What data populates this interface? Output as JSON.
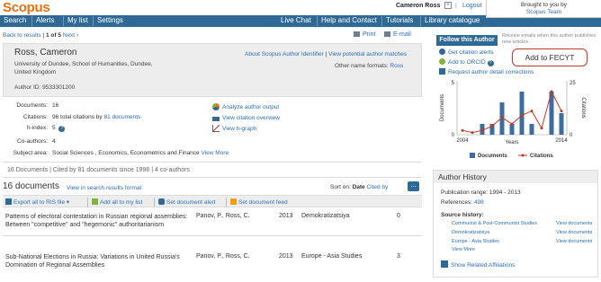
{
  "header": {
    "logo": "Scopus",
    "user_name": "Cameron Ross",
    "user_plus": "+",
    "logout": "Logout",
    "brought_line1": "Brought to you by",
    "brought_line2": "Scopus Team"
  },
  "nav": {
    "left": [
      "Search",
      "Alerts",
      "My list",
      "Settings"
    ],
    "right": [
      "Live Chat",
      "Help and Contact",
      "Tutorials",
      "Library catalogue"
    ]
  },
  "subbar": {
    "back": "Back to results",
    "pager": "1 of 5",
    "next": "Next",
    "print": "Print",
    "email": "E-mail"
  },
  "author": {
    "name": "Ross, Cameron",
    "affiliation": "University of Dundee, School of Humanities, Dundee, United Kingdom",
    "author_id": "Author ID: 9533301200",
    "about_link": "About Scopus Author Identifier",
    "sep": "|",
    "potential_link": "View potential author matches",
    "other_formats_label": "Other name formats:",
    "other_formats_value": "Ross"
  },
  "metrics": {
    "documents_label": "Documents:",
    "documents_value": "16",
    "citations_label": "Citations:",
    "citations_value_pre": "96 total citations by",
    "citations_link": "81 documents",
    "hindex_label": "h-index:",
    "hindex_value": "5",
    "coauthors_label": "Co-authors:",
    "coauthors_value": "4",
    "subject_label": "Subject area:",
    "subject_value": "Social Sciences ,  Economics, Econometrics and Finance",
    "view_more": "View More",
    "analyze_link": "Analyze author output",
    "citation_overview_link": "View citation overview",
    "hgraph_link": "View h-graph"
  },
  "summary": {
    "docs": "16 Documents",
    "cited": "Cited by 81 documents since 1996",
    "coauthors": "4 co-authors",
    "sep": "|"
  },
  "documents": {
    "heading": "16 documents",
    "view_search": "View in search results format",
    "sort_label": "Sort on:",
    "sort_date": "Date",
    "sort_cited": "Cited by",
    "sort_btn": "...",
    "toolbar": {
      "export": "Export all to RIS file",
      "add": "Add all to my list",
      "alert": "Set document alert",
      "feed": "Set document feed"
    },
    "rows": [
      {
        "title": "Patterns of electoral contestation in Russian regional assemblies: Between \"competitive\" and \"hegemonic\" authoritarianism",
        "authors": "Panov, P., Ross, C.",
        "year": "2013",
        "source": "Demokratizatsiya",
        "cited": "0"
      },
      {
        "title": "Sub-National Elections in Russia: Variations in United Russia's Domination of Regional Assemblies",
        "authors": "Panov, P., Ross, C.",
        "year": "2013",
        "source": "Europe - Asia Studies",
        "cited": "3"
      }
    ]
  },
  "right": {
    "follow_btn": "Follow this Author",
    "follow_txt": "Receive emails when this author publishes new articles",
    "get_alerts": "Get citation alerts",
    "add_orcid": "Add to ORCID",
    "q": "?",
    "request": "Request author detail corrections",
    "callout": "Add to FECYT"
  },
  "chart_data": {
    "type": "bar",
    "x": [
      2004,
      2005,
      2006,
      2007,
      2008,
      2009,
      2010,
      2011,
      2012,
      2013,
      2014
    ],
    "series": [
      {
        "name": "Documents",
        "values": [
          0,
          0,
          1,
          1,
          3,
          1,
          4,
          1,
          0,
          4,
          2
        ]
      },
      {
        "name": "Citations",
        "values": [
          2,
          1,
          2,
          4,
          8,
          5,
          9,
          11,
          3,
          20,
          11
        ]
      }
    ],
    "xlabel": "Years",
    "ylabel_left": "Documents",
    "ylabel_right": "Citations",
    "xtick_labels": [
      "2004",
      "2014"
    ],
    "yticks_left": [
      "0",
      "5"
    ],
    "yticks_right": [
      "0",
      "25"
    ],
    "ylim_left": [
      0,
      5
    ],
    "ylim_right": [
      0,
      25
    ],
    "legend": [
      "Documents",
      "Citations"
    ],
    "legend_placement": "bottom",
    "colors": {
      "Documents": "#3d6ca0",
      "Citations": "#c0392b"
    }
  },
  "history": {
    "heading": "Author History",
    "pub_range_label": "Publication range:",
    "pub_range_value": "1994 - 2013",
    "references_label": "References:",
    "references_value": "498",
    "source_label": "Source history:",
    "sources": [
      "Communist & Post-Communist Studies",
      "Demokratizatsiya",
      "Europe - Asia Studies"
    ],
    "view_docs": "View documents",
    "view_more": "View More",
    "show_affiliations": "Show Related Affiliations"
  },
  "colors": {
    "brand": "#e8700a",
    "nav": "#2f6a96",
    "link": "#2a6ebb"
  }
}
